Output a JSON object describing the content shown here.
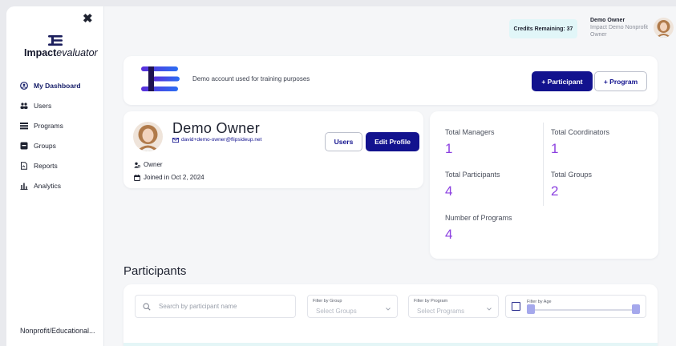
{
  "sidebar": {
    "close_glyph": "✖",
    "brand": {
      "bold": "Impact",
      "italic": "evaluator"
    },
    "nav": [
      {
        "label": "My Dashboard",
        "icon": "dashboard-icon",
        "active": true
      },
      {
        "label": "Users",
        "icon": "users-icon"
      },
      {
        "label": "Programs",
        "icon": "programs-icon"
      },
      {
        "label": "Groups",
        "icon": "groups-icon"
      },
      {
        "label": "Reports",
        "icon": "reports-icon"
      },
      {
        "label": "Analytics",
        "icon": "analytics-icon"
      }
    ],
    "org": "Nonprofit/Educational..."
  },
  "topbar": {
    "credits": "Credits Remaining: 37",
    "user_name": "Demo  Owner",
    "user_org": "Impact Demo Nonprofit",
    "user_role": "Owner"
  },
  "banner": {
    "text": "Demo account used for training purposes",
    "add_participant": "+ Participant",
    "add_program": "+ Program"
  },
  "profile": {
    "name": "Demo  Owner",
    "email": "david+demo-owner@flipsideup.net",
    "role": "Owner",
    "joined": "Joined in Oct 2, 2024",
    "users_btn": "Users",
    "edit_btn": "Edit Profile"
  },
  "stats": [
    {
      "label": "Total Managers",
      "value": "1"
    },
    {
      "label": "Total Coordinators",
      "value": "1"
    },
    {
      "label": "Total Participants",
      "value": "4"
    },
    {
      "label": "Total Groups",
      "value": "2"
    },
    {
      "label": "Number of Programs",
      "value": "4"
    }
  ],
  "participants": {
    "title": "Participants",
    "search_placeholder": "Search by participant name",
    "filter_group_label": "Filter by Group",
    "filter_group_placeholder": "Select Groups",
    "filter_program_label": "Filter by Program",
    "filter_program_placeholder": "Select Programs",
    "filter_age_label": "Filter by Age"
  },
  "colors": {
    "accent": "#12128e",
    "stat_value": "#8b3fe0",
    "credits_bg": "#e1f6f8"
  }
}
